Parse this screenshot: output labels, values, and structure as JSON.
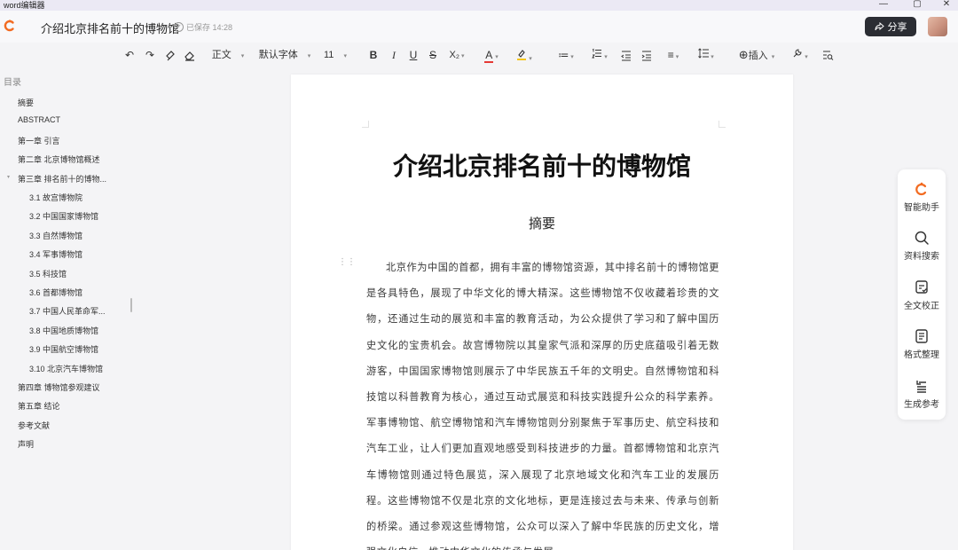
{
  "window": {
    "app_name": "word编辑器",
    "controls": {
      "minimize": "—",
      "maximize": "▢",
      "close": "✕"
    }
  },
  "header": {
    "doc_title": "介绍北京排名前十的博物馆",
    "saved_status": "已保存 14:28",
    "share_label": "分享",
    "share_icon": "share-arrow-icon"
  },
  "toolbar": {
    "undo": "↶",
    "redo": "↷",
    "format_painter": "brush-icon",
    "clear_format": "eraser-icon",
    "style_value": "正文",
    "font_value": "默认字体",
    "size_value": "11",
    "bold": "B",
    "italic": "I",
    "underline": "U",
    "strike": "S",
    "subscript": "X₂",
    "font_color": "A",
    "highlight": "highlight-icon",
    "bullet_list": "≔",
    "numbered_list": "numbered-list-icon",
    "outdent": "outdent-icon",
    "indent": "indent-icon",
    "align": "≡",
    "line_spacing": "line-spacing-icon",
    "insert_label": "插入",
    "insert_icon": "⊕",
    "tools_icon": "tools-icon",
    "find_icon": "find-replace-icon",
    "colors": {
      "font_color_bar": "#e53935",
      "highlight_bar": "#f5c518"
    }
  },
  "toc": {
    "title": "目录",
    "items": [
      {
        "label": "摘要",
        "level": 1
      },
      {
        "label": "ABSTRACT",
        "level": 1
      },
      {
        "label": "第一章 引言",
        "level": 1
      },
      {
        "label": "第二章 北京博物馆概述",
        "level": 1
      },
      {
        "label": "第三章 排名前十的博物...",
        "level": 1,
        "expanded": true
      },
      {
        "label": "3.1 故宫博物院",
        "level": 2
      },
      {
        "label": "3.2 中国国家博物馆",
        "level": 2
      },
      {
        "label": "3.3 自然博物馆",
        "level": 2
      },
      {
        "label": "3.4 军事博物馆",
        "level": 2
      },
      {
        "label": "3.5 科技馆",
        "level": 2
      },
      {
        "label": "3.6 首都博物馆",
        "level": 2
      },
      {
        "label": "3.7 中国人民革命军...",
        "level": 2
      },
      {
        "label": "3.8 中国地质博物馆",
        "level": 2
      },
      {
        "label": "3.9 中国航空博物馆",
        "level": 2
      },
      {
        "label": "3.10 北京汽车博物馆",
        "level": 2
      },
      {
        "label": "第四章 博物馆参观建议",
        "level": 1
      },
      {
        "label": "第五章 结论",
        "level": 1
      },
      {
        "label": "参考文献",
        "level": 1
      },
      {
        "label": "声明",
        "level": 1
      }
    ]
  },
  "document": {
    "heading": "介绍北京排名前十的博物馆",
    "abstract_title": "摘要",
    "abstract_body": "北京作为中国的首都，拥有丰富的博物馆资源，其中排名前十的博物馆更是各具特色，展现了中华文化的博大精深。这些博物馆不仅收藏着珍贵的文物，还通过生动的展览和丰富的教育活动，为公众提供了学习和了解中国历史文化的宝贵机会。故宫博物院以其皇家气派和深厚的历史底蕴吸引着无数游客，中国国家博物馆则展示了中华民族五千年的文明史。自然博物馆和科技馆以科普教育为核心，通过互动式展览和科技实践提升公众的科学素养。军事博物馆、航空博物馆和汽车博物馆则分别聚焦于军事历史、航空科技和汽车工业，让人们更加直观地感受到科技进步的力量。首都博物馆和北京汽车博物馆则通过特色展览，深入展现了北京地域文化和汽车工业的发展历程。这些博物馆不仅是北京的文化地标，更是连接过去与未来、传承与创新的桥梁。通过参观这些博物馆，公众可以深入了解中华民族的历史文化，增强文化自信，推动中华文化的传承与发展。"
  },
  "assistant_panel": {
    "items": [
      {
        "label": "智能助手",
        "icon": "ai-assistant-icon"
      },
      {
        "label": "资料搜索",
        "icon": "search-icon"
      },
      {
        "label": "全文校正",
        "icon": "proofread-icon"
      },
      {
        "label": "格式整理",
        "icon": "format-icon"
      },
      {
        "label": "生成参考",
        "icon": "reference-icon"
      }
    ],
    "brand_color": "#f26b21"
  }
}
